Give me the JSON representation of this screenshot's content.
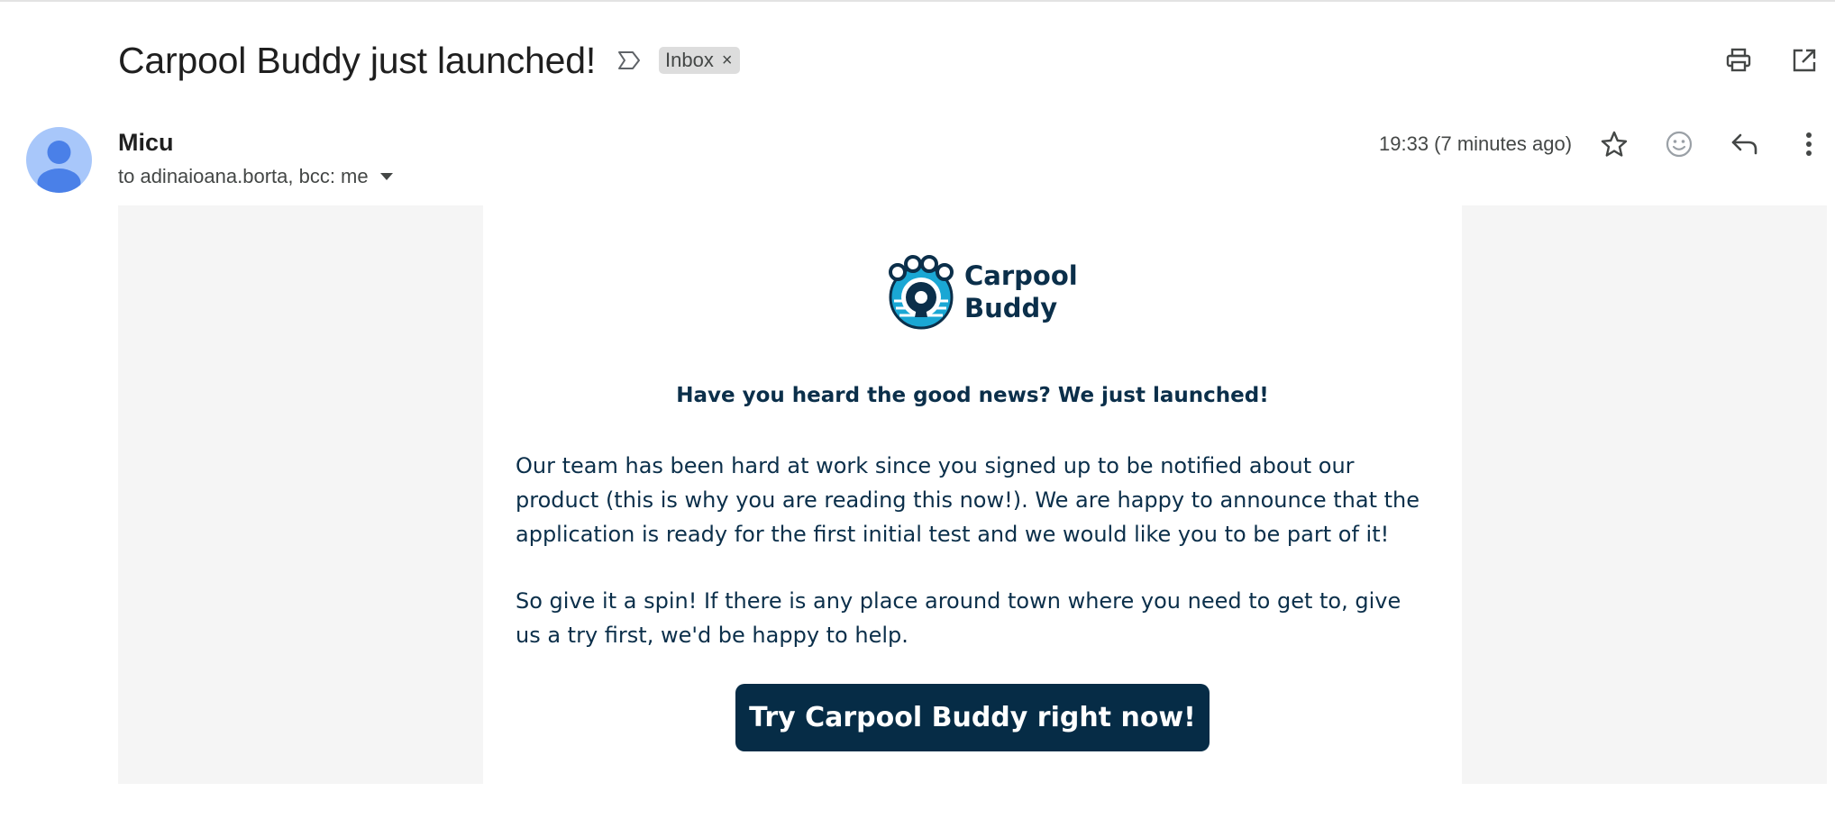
{
  "email": {
    "subject": "Carpool Buddy just launched!",
    "label": "Inbox",
    "label_remove": "×",
    "sender": "Micu",
    "recipients": "to adinaioana.borta, bcc: me",
    "timestamp": "19:33 (7 minutes ago)"
  },
  "icons": {
    "importance": "important-marker-icon",
    "print": "print-icon",
    "open_new_window": "open-in-new-window-icon",
    "star": "star-icon",
    "emoji": "emoji-reaction-icon",
    "reply": "reply-icon",
    "more": "more-options-icon",
    "recipients_dropdown": "dropdown-arrow-icon"
  },
  "body": {
    "logo_line1": "Carpool",
    "logo_line2": "Buddy",
    "headline": "Have you heard the good news? We just launched!",
    "paragraph1": "Our team has been hard at work since you signed up to be notified about our product (this is why you are reading this now!). We are happy to announce that the application is ready for the first initial test and we would like you to be part of it!",
    "paragraph2": "So give it a spin! If there is any place around town where you need to get to, give us a try first, we'd be happy to help.",
    "cta": "Try Carpool Buddy right now!"
  },
  "colors": {
    "brand_navy": "#062c46",
    "brand_text": "#0b2f4a",
    "brand_cyan": "#1aa7d4",
    "avatar_bg": "#a8c7fa",
    "avatar_fg": "#4a80e8",
    "frame_gray": "#f5f5f5"
  }
}
